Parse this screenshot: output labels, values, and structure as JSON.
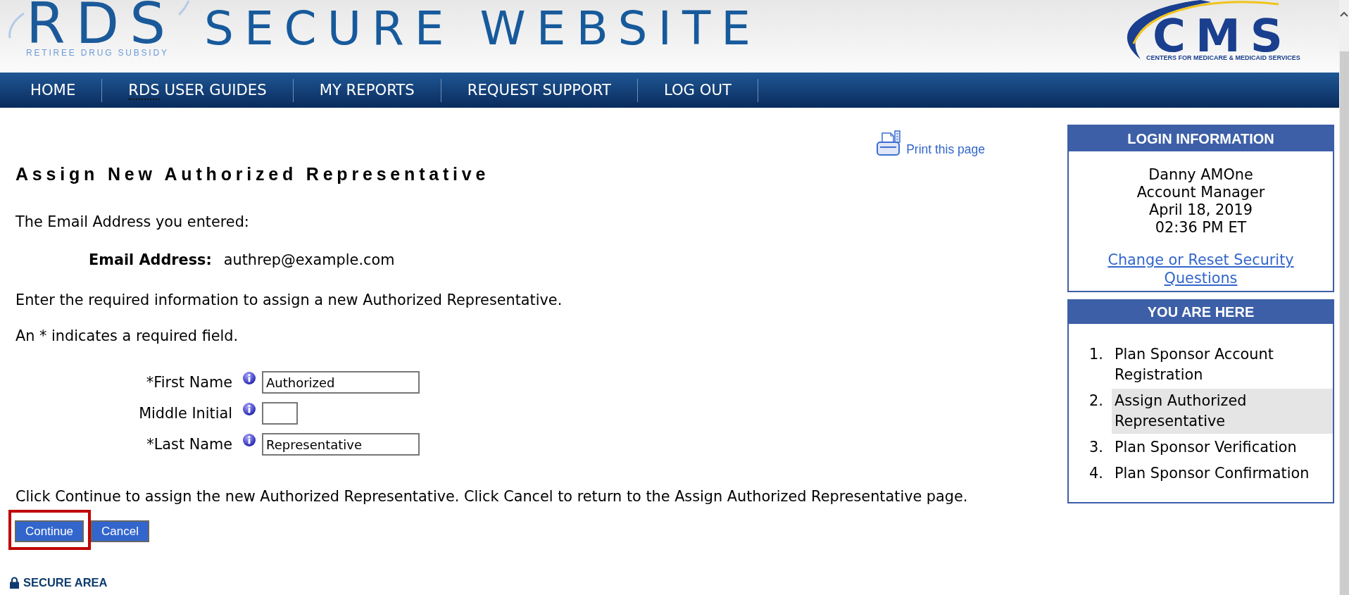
{
  "header": {
    "logo": {
      "text": "RDS",
      "caption": "RETIREE DRUG SUBSIDY"
    },
    "title": "SECURE WEBSITE",
    "agency_logo": {
      "text": "CMS",
      "caption": "CENTERS FOR MEDICARE & MEDICAID SERVICES"
    }
  },
  "nav": [
    {
      "label": "HOME",
      "abbr_underline": false
    },
    {
      "label": "RDS USER GUIDES",
      "abbr_underline": true
    },
    {
      "label": "MY REPORTS",
      "abbr_underline": false
    },
    {
      "label": "REQUEST SUPPORT",
      "abbr_underline": false
    },
    {
      "label": "LOG OUT",
      "abbr_underline": false
    }
  ],
  "content": {
    "print_link": "Print this page",
    "title": "Assign New Authorized Representative",
    "intro": "The Email Address you entered:",
    "email": {
      "label": "Email Address:",
      "value": "authrep@example.com"
    },
    "instructions": [
      "Enter the required information to assign a new Authorized Representative.",
      "An * indicates a required field."
    ],
    "fields": [
      {
        "label": "*First Name",
        "kind": "name",
        "value": "Authorized"
      },
      {
        "label": "Middle Initial",
        "kind": "initial"
      },
      {
        "label": "*Last Name",
        "kind": "name",
        "value": "Representative"
      }
    ],
    "note": "Click Continue to assign the new Authorized Representative. Click Cancel to return to the Assign Authorized Representative page.",
    "buttons": [
      {
        "label": "Continue",
        "highlighted": true
      },
      {
        "label": "Cancel",
        "highlighted": false
      }
    ],
    "secure_area": "SECURE AREA"
  },
  "sidebar": {
    "login_info": {
      "title": "LOGIN INFORMATION",
      "lines": [
        "Danny AMOne",
        "Account Manager",
        "April 18, 2019",
        "02:36 PM ET"
      ],
      "link": "Change or Reset Security Questions"
    },
    "progress": {
      "title": "YOU ARE HERE",
      "steps": [
        {
          "number": "1.",
          "label": "Plan Sponsor Account Registration",
          "selected": false
        },
        {
          "number": "2.",
          "label": "Assign Authorized Representative",
          "selected": true
        },
        {
          "number": "3.",
          "label": "Plan Sponsor Verification",
          "selected": false
        },
        {
          "number": "4.",
          "label": "Plan Sponsor Confirmation",
          "selected": false
        }
      ]
    }
  }
}
